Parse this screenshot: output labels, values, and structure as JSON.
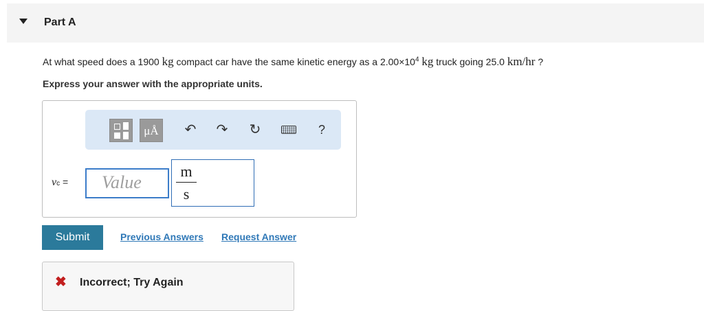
{
  "part": {
    "title": "Part A"
  },
  "question": {
    "t1": "At what speed does a 1900",
    "kg": "kg",
    "t2": "compact car have the same kinetic energy as a 2.00×10",
    "exp": "4",
    "t3": "truck going 25.0",
    "speed_unit": "km/hr",
    "t4": "?"
  },
  "instruction": "Express your answer with the appropriate units.",
  "toolbar": {
    "units_glyph": "μÅ",
    "undo_glyph": "↶",
    "redo_glyph": "↷",
    "reset_glyph": "↻",
    "help_glyph": "?"
  },
  "answer": {
    "variable": "v",
    "subscript": "c",
    "equals": "=",
    "value_placeholder": "Value",
    "unit_numerator": "m",
    "unit_denominator": "s"
  },
  "actions": {
    "submit": "Submit",
    "previous_answers": "Previous Answers",
    "request_answer": "Request Answer"
  },
  "feedback": {
    "icon": "✖",
    "text": "Incorrect; Try Again"
  },
  "colors": {
    "submit_bg": "#2b7a9b",
    "link": "#2f78b7",
    "error": "#c21f1f",
    "toolbar_bg": "#dbe8f6"
  }
}
